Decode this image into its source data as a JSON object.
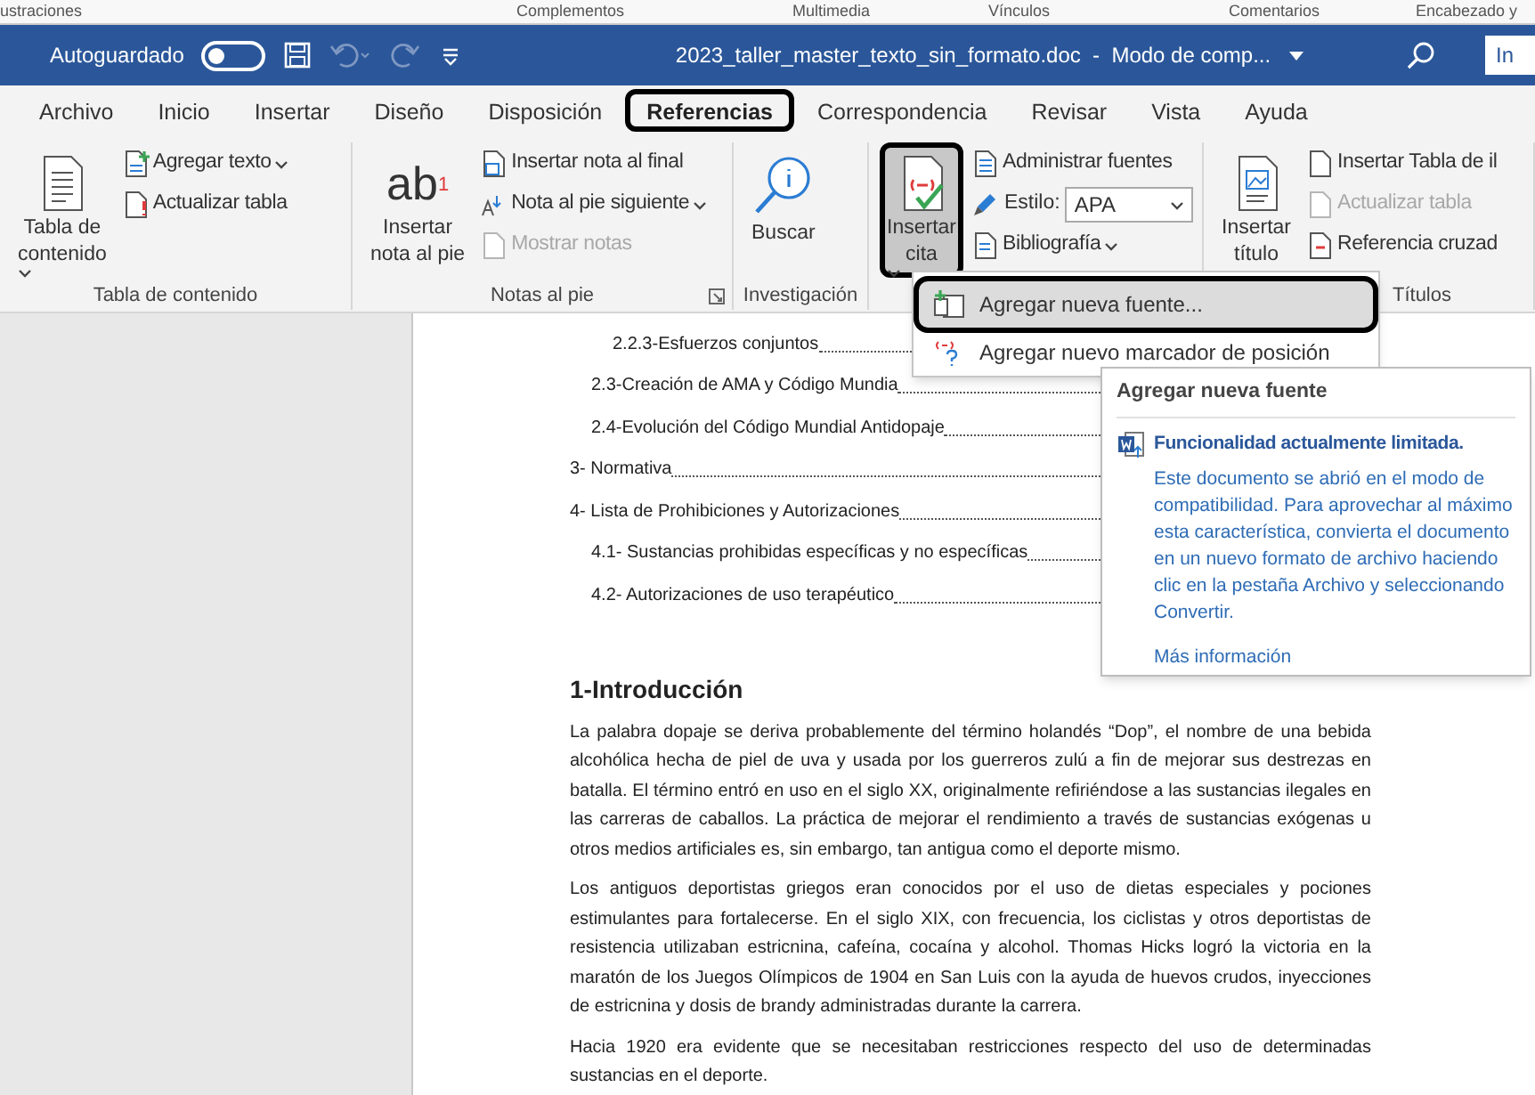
{
  "background_ribbon_labels": [
    "ustraciones",
    "Complementos",
    "Multimedia",
    "Vínculos",
    "Comentarios",
    "Encabezado y"
  ],
  "title_bar": {
    "autosave_label": "Autoguardado",
    "autosave_on": false,
    "title": "2023_taller_master_texto_sin_formato.doc  -  Modo de comp...",
    "signin": "In"
  },
  "tabs": [
    {
      "label": "Archivo",
      "selected": false,
      "highlighted": false
    },
    {
      "label": "Inicio",
      "selected": false,
      "highlighted": false
    },
    {
      "label": "Insertar",
      "selected": false,
      "highlighted": false
    },
    {
      "label": "Diseño",
      "selected": false,
      "highlighted": false
    },
    {
      "label": "Disposición",
      "selected": false,
      "highlighted": false
    },
    {
      "label": "Referencias",
      "selected": true,
      "highlighted": true
    },
    {
      "label": "Correspondencia",
      "selected": false,
      "highlighted": false
    },
    {
      "label": "Revisar",
      "selected": false,
      "highlighted": false
    },
    {
      "label": "Vista",
      "selected": false,
      "highlighted": false
    },
    {
      "label": "Ayuda",
      "selected": false,
      "highlighted": false
    }
  ],
  "ribbon": {
    "groups": [
      {
        "label": "Tabla de contenido",
        "items": [
          {
            "kind": "large",
            "lines": [
              "Tabla de",
              "contenido"
            ],
            "dropdown": true
          },
          {
            "kind": "small",
            "label": "Agregar texto",
            "dropdown": true
          },
          {
            "kind": "small",
            "label": "Actualizar tabla"
          }
        ]
      },
      {
        "label": "Notas al pie",
        "launcher": true,
        "items": [
          {
            "kind": "large",
            "glyph": "ab",
            "glyph_sup": "1",
            "lines": [
              "Insertar",
              "nota al pie"
            ]
          },
          {
            "kind": "small",
            "label": "Insertar nota al final"
          },
          {
            "kind": "small",
            "label": "Nota al pie siguiente",
            "dropdown": true
          },
          {
            "kind": "small",
            "label": "Mostrar notas",
            "disabled": true
          }
        ]
      },
      {
        "label": "Investigación",
        "items": [
          {
            "kind": "large",
            "lines": [
              "Buscar"
            ]
          }
        ]
      },
      {
        "items": [
          {
            "kind": "large",
            "lines": [
              "Insertar",
              "cita"
            ],
            "dropdown": true,
            "pressed": true,
            "highlighted": true
          },
          {
            "kind": "small",
            "label": "Administrar fuentes"
          },
          {
            "kind": "select",
            "label": "Estilo:",
            "value": "APA"
          },
          {
            "kind": "small",
            "label": "Bibliografía",
            "dropdown": true
          }
        ]
      },
      {
        "label": "Títulos",
        "items": [
          {
            "kind": "large",
            "lines": [
              "Insertar",
              "título"
            ]
          },
          {
            "kind": "small",
            "label": "Insertar Tabla de il"
          },
          {
            "kind": "small",
            "label": "Actualizar tabla",
            "disabled": true
          },
          {
            "kind": "small",
            "label": "Referencia cruzad"
          }
        ]
      }
    ]
  },
  "citation_menu": [
    {
      "label": "Agregar nueva fuente...",
      "selected": true,
      "highlighted": true
    },
    {
      "label": "Agregar nuevo marcador de posición",
      "selected": false,
      "highlighted": false
    }
  ],
  "tooltip": {
    "title": "Agregar nueva fuente",
    "warning": "Funcionalidad actualmente limitada.",
    "body": "Este documento se abrió en el modo de compatibilidad. Para aprovechar al máximo esta característica, convierta el documento en un nuevo formato de archivo haciendo clic en la pestaña Archivo y seleccionando Convertir.",
    "link": "Más información"
  },
  "toc": [
    {
      "children": [
        {
          "children": [
            {
              "text": "2.2.3-Esfuerzos conjuntos"
            }
          ]
        },
        {
          "text": "2.3-Creación de AMA y Código Mundia"
        },
        {
          "text": "2.4-Evolución del Código Mundial Antidopaje"
        }
      ]
    },
    {
      "text": "3- Normativa"
    },
    {
      "text": "4- Lista de Prohibiciones y Autorizaciones",
      "children": [
        {
          "text": "4.1- Sustancias prohibidas específicas y no específicas"
        },
        {
          "text": "4.2- Autorizaciones de uso terapéutico"
        }
      ]
    }
  ],
  "heading": "1-Introducción",
  "paragraphs": [
    "La palabra dopaje se deriva probablemente del término holandés “Dop”, el nombre de una bebida alcohólica hecha de piel de uva y usada por los guerreros zulú a fin de mejorar sus destrezas en batalla. El término entró en uso en el siglo XX, originalmente refiriéndose a las sustancias ilegales en las carreras de caballos. La práctica de mejorar el rendimiento a través de sustancias exógenas u otros medios artificiales es, sin embargo, tan antigua como el deporte mismo.",
    "Los antiguos deportistas griegos eran conocidos por el uso de dietas especiales y pociones estimulantes para fortalecerse. En el siglo XIX, con frecuencia, los ciclistas y otros deportistas de resistencia utilizaban estricnina, cafeína, cocaína y alcohol. Thomas Hicks logró la victoria en la maratón de los Juegos Olímpicos de 1904 en San Luis con la ayuda de huevos crudos, inyecciones de estricnina y dosis de brandy administradas durante la carrera.",
    "Hacia 1920 era evidente que se necesitaban restricciones respecto del uso de determinadas sustancias en el deporte."
  ]
}
